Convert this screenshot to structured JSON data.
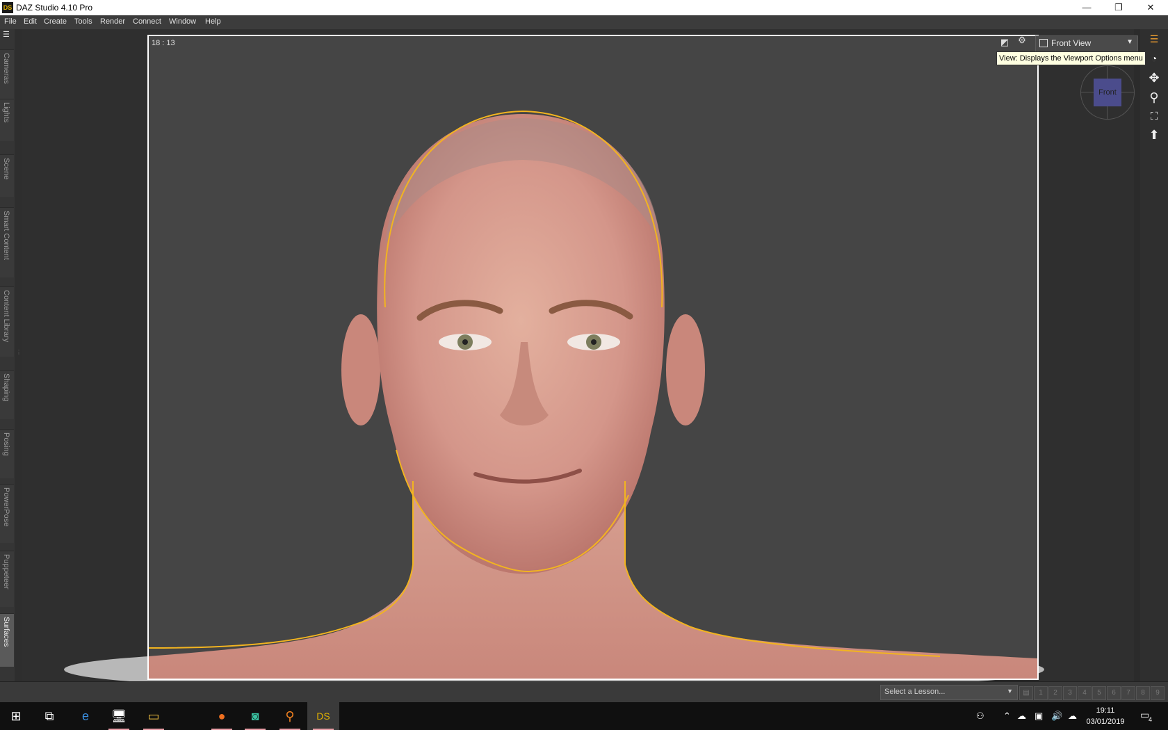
{
  "window": {
    "title": "DAZ Studio 4.10 Pro",
    "icon_text": "DS",
    "minimize": "—",
    "restore": "❐",
    "close": "✕"
  },
  "menu": [
    "File",
    "Edit",
    "Create",
    "Tools",
    "Render",
    "Connect",
    "Window",
    "Help"
  ],
  "left_tabs": [
    "Cameras",
    "Lights",
    "Scene",
    "Smart Content",
    "Content Library",
    "Shaping",
    "Posing",
    "PowerPose",
    "Puppeteer",
    "Surfaces"
  ],
  "active_left_tab": "Surfaces",
  "viewport": {
    "aspect_ratio": "18 : 13",
    "view_dropdown": "Front View",
    "tooltip": "View: Displays the Viewport Options menu",
    "nav_cube_face": "Front"
  },
  "status_bar": {
    "lesson_placeholder": "Select a Lesson...",
    "step_buttons": [
      "1",
      "2",
      "3",
      "4",
      "5",
      "6",
      "7",
      "8",
      "9"
    ]
  },
  "taskbar": {
    "clock_time": "19:11",
    "clock_date": "03/01/2019",
    "notification_count": "4"
  },
  "colors": {
    "selection_outline": "#f2b420",
    "viewport_bg": "#454545",
    "nav_cube": "#4b4c8c",
    "tooltip_bg": "#ffffe1"
  }
}
